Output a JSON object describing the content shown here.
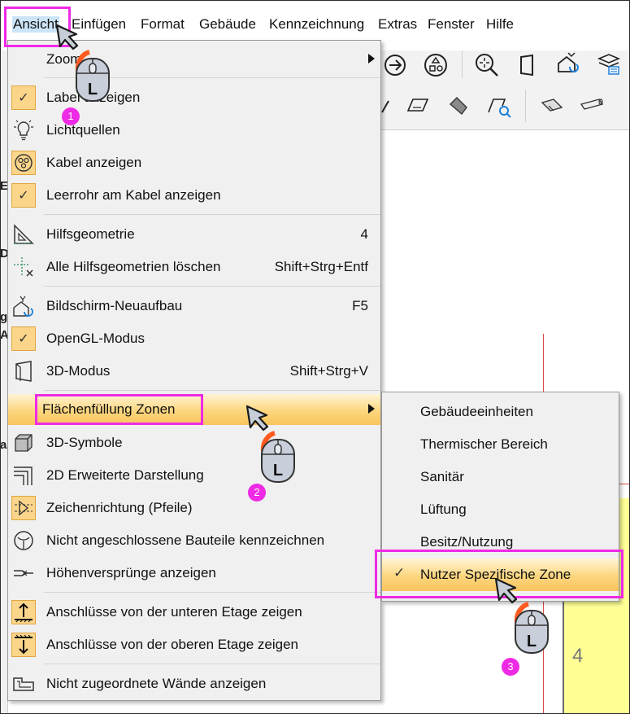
{
  "menubar": {
    "items": [
      "Ansicht",
      "Einfügen",
      "Format",
      "Gebäude",
      "Kennzeichnung",
      "Extras",
      "Fenster",
      "Hilfe"
    ]
  },
  "menu": {
    "items": [
      {
        "label": "Zoom",
        "shortcut": "",
        "icon": "zoom-icon",
        "submenu": true
      },
      {
        "label": "Label anzeigen",
        "shortcut": "",
        "icon": "check-icon",
        "checked": true
      },
      {
        "label": "Lichtquellen",
        "shortcut": "",
        "icon": "lightbulb-icon"
      },
      {
        "label": "Kabel anzeigen",
        "shortcut": "",
        "icon": "cable-icon",
        "checked": true
      },
      {
        "label": "Leerrohr am Kabel anzeigen",
        "shortcut": "",
        "icon": "check-icon",
        "checked": true
      },
      {
        "label": "Hilfsgeometrie",
        "shortcut": "4",
        "icon": "set-square-icon"
      },
      {
        "label": "Alle Hilfsgeometrien löschen",
        "shortcut": "Shift+Strg+Entf",
        "icon": "delete-guides-icon"
      },
      {
        "label": "Bildschirm-Neuaufbau",
        "shortcut": "F5",
        "icon": "redraw-icon"
      },
      {
        "label": "OpenGL-Modus",
        "shortcut": "",
        "icon": "check-icon",
        "checked": true
      },
      {
        "label": "3D-Modus",
        "shortcut": "Shift+Strg+V",
        "icon": "cube-3d-icon"
      },
      {
        "label": "Flächenfüllung Zonen",
        "shortcut": "",
        "icon": "",
        "submenu": true,
        "highlighted": true
      },
      {
        "label": "3D-Symbole",
        "shortcut": "",
        "icon": "3d-symbol-icon"
      },
      {
        "label": "2D Erweiterte Darstellung",
        "shortcut": "",
        "icon": "2d-extended-icon"
      },
      {
        "label": "Zeichenrichtung (Pfeile)",
        "shortcut": "",
        "icon": "direction-arrow-icon",
        "checked": true
      },
      {
        "label": "Nicht angeschlossene Bauteile kennzeichnen",
        "shortcut": "",
        "icon": "unconnected-icon"
      },
      {
        "label": "Höhenversprünge anzeigen",
        "shortcut": "",
        "icon": "height-offset-icon"
      },
      {
        "label": "Anschlüsse von der unteren Etage zeigen",
        "shortcut": "",
        "icon": "floor-below-icon",
        "checked": true
      },
      {
        "label": "Anschlüsse von der oberen Etage zeigen",
        "shortcut": "",
        "icon": "floor-above-icon",
        "checked": true
      },
      {
        "label": "Nicht zugeordnete Wände anzeigen",
        "shortcut": "",
        "icon": "unassigned-walls-icon"
      }
    ]
  },
  "submenu": {
    "items": [
      {
        "label": "Gebäudeeinheiten"
      },
      {
        "label": "Thermischer Bereich"
      },
      {
        "label": "Sanitär"
      },
      {
        "label": "Lüftung"
      },
      {
        "label": "Besitz/Nutzung"
      },
      {
        "label": "Nutzer Spezifische Zone",
        "checked": true,
        "highlighted": true
      }
    ]
  },
  "callouts": {
    "step1": "1",
    "step2": "2",
    "step3": "3",
    "mouse_button": "L"
  },
  "canvas": {
    "zone_number": "4",
    "left_strip_chars": [
      "E",
      "D",
      "g",
      "A",
      "a"
    ]
  },
  "colors": {
    "highlight_border": "#ee2ae5",
    "hover_gradient": "#fcd67e",
    "check_bg": "#fbd58a",
    "zone_fill": "#ffff96"
  }
}
